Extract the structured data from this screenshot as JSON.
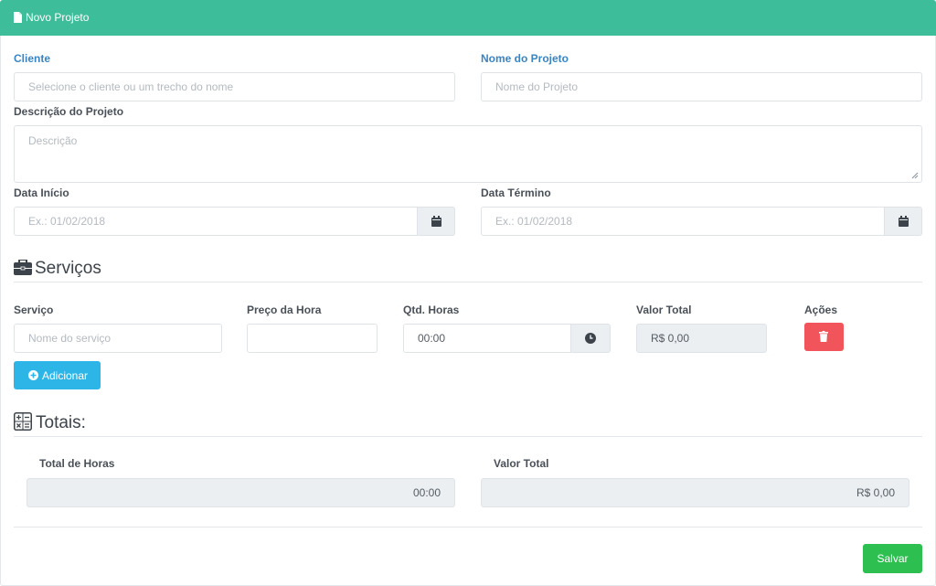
{
  "header": {
    "title": "Novo Projeto",
    "icon": "file-icon"
  },
  "form": {
    "client": {
      "label": "Cliente",
      "placeholder": "Selecione o cliente ou um trecho do nome"
    },
    "project_name": {
      "label": "Nome do Projeto",
      "placeholder": "Nome do Projeto"
    },
    "description": {
      "label": "Descrição do Projeto",
      "placeholder": "Descrição"
    },
    "start_date": {
      "label": "Data Início",
      "placeholder": "Ex.: 01/02/2018"
    },
    "end_date": {
      "label": "Data Término",
      "placeholder": "Ex.: 01/02/2018"
    }
  },
  "services": {
    "title": "Serviços",
    "columns": {
      "service": "Serviço",
      "hour_price": "Preço da Hora",
      "qty_hours": "Qtd. Horas",
      "total_value": "Valor Total",
      "actions": "Ações"
    },
    "row": {
      "service_placeholder": "Nome do serviço",
      "hour_price": "",
      "qty_hours": "00:00",
      "total_value": "R$ 0,00"
    },
    "add_label": "Adicionar"
  },
  "totals": {
    "title": "Totais:",
    "total_hours_label": "Total de Horas",
    "total_hours_value": "00:00",
    "total_value_label": "Valor Total",
    "total_value_value": "R$ 0,00"
  },
  "footer": {
    "save_label": "Salvar"
  },
  "colors": {
    "header": "#3dbd9a",
    "add_button": "#2eb5e8",
    "delete_button": "#f1545a",
    "save_button": "#2dbf4f",
    "label_blue": "#3b84c2"
  }
}
